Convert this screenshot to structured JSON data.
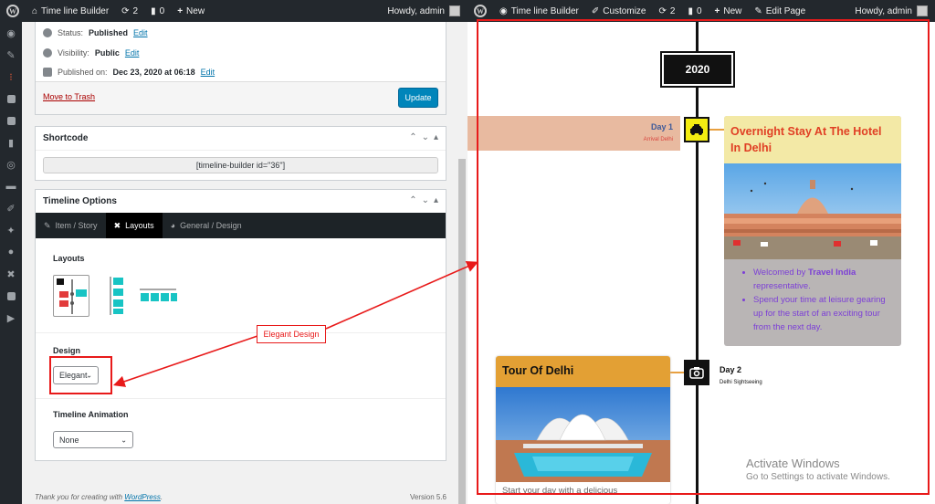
{
  "left_admin_bar": {
    "site_title": "Time line Builder",
    "updates_count": "2",
    "comments_count": "0",
    "new_label": "New",
    "greeting": "Howdy, admin"
  },
  "publish": {
    "status_label": "Status:",
    "status_value": "Published",
    "visibility_label": "Visibility:",
    "visibility_value": "Public",
    "published_label": "Published on:",
    "published_value": "Dec 23, 2020 at 06:18",
    "edit_label": "Edit",
    "trash_label": "Move to Trash",
    "update_label": "Update"
  },
  "shortcode": {
    "title": "Shortcode",
    "value": "[timeline-builder id=\"36\"]"
  },
  "timeline_options": {
    "title": "Timeline Options",
    "tabs": [
      {
        "label": "Item / Story",
        "icon": "pin-icon"
      },
      {
        "label": "Layouts",
        "icon": "cross-icon"
      },
      {
        "label": "General / Design",
        "icon": "palette-icon"
      }
    ],
    "layouts_label": "Layouts",
    "design_label": "Design",
    "design_value": "Elegant",
    "animation_label": "Timeline Animation",
    "animation_value": "None"
  },
  "annotation": {
    "label": "Elegant Design"
  },
  "footer": {
    "thanks_prefix": "Thank you for creating with ",
    "thanks_link": "WordPress",
    "thanks_suffix": ".",
    "version": "Version 5.6"
  },
  "right_admin_bar": {
    "site_title": "Time line Builder",
    "customize_label": "Customize",
    "updates_count": "2",
    "comments_count": "0",
    "new_label": "New",
    "edit_page_label": "Edit Page",
    "greeting": "Howdy, admin"
  },
  "timeline": {
    "year": "2020",
    "day1": {
      "title": "Day 1",
      "subtitle": "Arrival Delhi",
      "card_title": "Overnight Stay At The Hotel In Delhi",
      "bullets": [
        {
          "prefix": "Welcomed by ",
          "bold": "Travel India",
          "suffix": " representative."
        },
        {
          "prefix": "Spend your time at leisure gearing up for the start of an exciting tour from the next day.",
          "bold": "",
          "suffix": ""
        }
      ]
    },
    "day2": {
      "title": "Day 2",
      "subtitle": "Delhi Sightseeing",
      "card_title": "Tour Of Delhi",
      "card_text": "Start your day with a delicious"
    }
  },
  "watermark": {
    "line1": "Activate Windows",
    "line2": "Go to Settings to activate Windows."
  },
  "colors": {
    "annotation_red": "#e81a1a",
    "admin_dark": "#23282d",
    "wp_blue": "#0085ba",
    "day1_band": "#e8baa0",
    "day1_card_head": "#f3e9a6",
    "day2_card_head": "#e3a034",
    "node_yellow": "#f4ed12"
  }
}
